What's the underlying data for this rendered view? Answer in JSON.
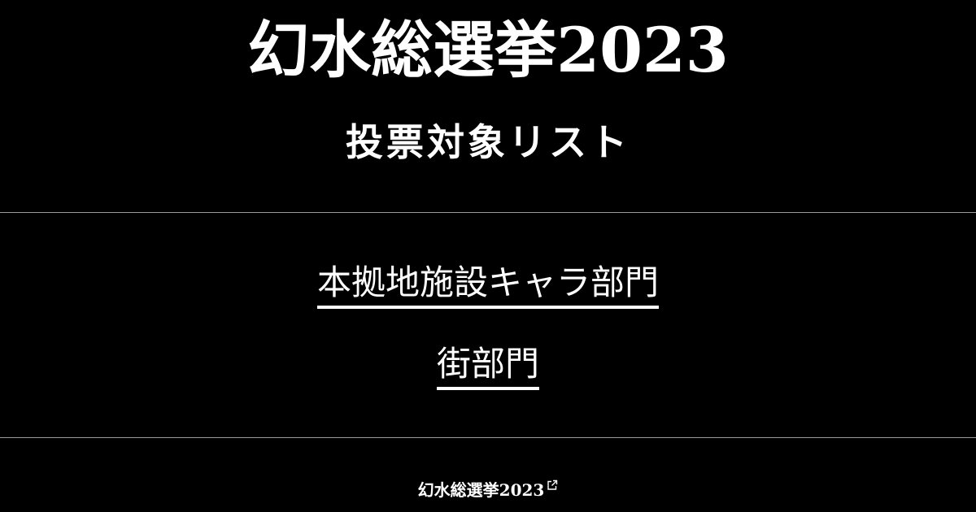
{
  "header": {
    "title": "幻水総選挙2023",
    "subtitle": "投票対象リスト"
  },
  "nav": {
    "items": [
      {
        "label": "本拠地施設キャラ部門"
      },
      {
        "label": "街部門"
      }
    ]
  },
  "footer": {
    "link_label": "幻水総選挙2023",
    "icon": "external-link-icon"
  },
  "colors": {
    "background": "#000000",
    "text": "#ffffff",
    "divider": "#9a9a9a"
  }
}
